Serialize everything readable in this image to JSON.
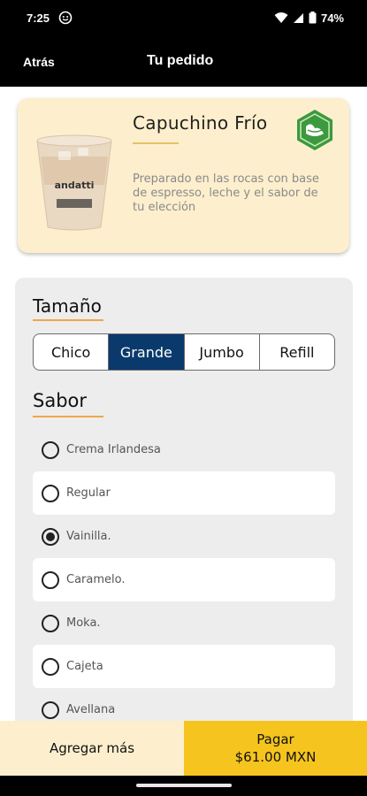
{
  "status_bar": {
    "time": "7:25",
    "battery": "74%"
  },
  "header": {
    "back_label": "Atrás",
    "title": "Tu pedido"
  },
  "product": {
    "name": "Capuchino Frío",
    "description": "Preparado en las rocas con base de espresso, leche y el sabor de tu elección",
    "cup_brand": "andatti",
    "badge_icon": "vegetarian-leaf-icon"
  },
  "size": {
    "title": "Tamaño",
    "options": [
      "Chico",
      "Grande",
      "Jumbo",
      "Refill"
    ],
    "selected": "Grande"
  },
  "flavor": {
    "title": "Sabor",
    "options": [
      "Crema Irlandesa",
      "Regular",
      "Vainilla.",
      "Caramelo.",
      "Moka.",
      "Cajeta",
      "Avellana"
    ],
    "selected": "Vainilla."
  },
  "bottom": {
    "add_more": "Agregar más",
    "pay_label": "Pagar",
    "pay_amount": "$61.00 MXN"
  },
  "colors": {
    "accent_navy": "#0a3a6b",
    "pay_yellow": "#f6c41e",
    "card_cream": "#fdefcd",
    "badge_green": "#3b9a3e",
    "underline_orange": "#f0a646"
  }
}
